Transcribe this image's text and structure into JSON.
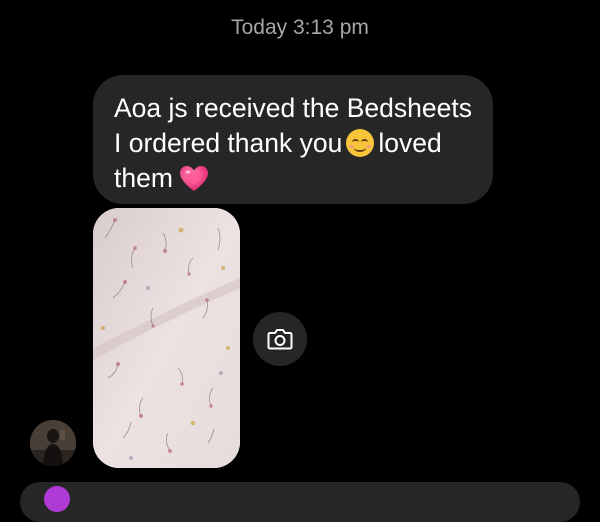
{
  "chat": {
    "timestamp": "Today 3:13 pm",
    "message": {
      "line1": "Aoa js received the Bedsheets",
      "line2_before": "I ordered thank you",
      "line2_after": "loved",
      "line3": "them",
      "emojis": [
        "smiling-face-emoji",
        "growing-heart-emoji"
      ]
    },
    "attachment": {
      "type": "photo",
      "subject": "floral bedsheet"
    },
    "camera_button": {
      "icon": "camera-icon"
    }
  },
  "colors": {
    "background": "#000000",
    "bubble": "#262626",
    "timestamp": "#a6a6a6",
    "heart": "#e8317a",
    "composer_accent": "#b03ad6"
  }
}
